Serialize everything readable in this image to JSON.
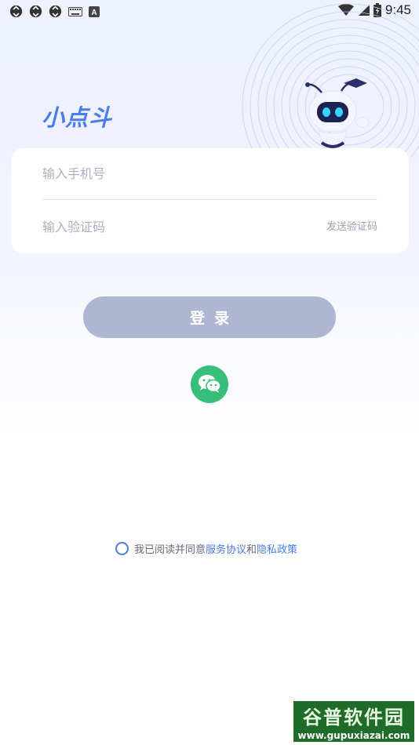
{
  "status_bar": {
    "time": "9:45",
    "left_icons": [
      "sync-icon",
      "sync-icon",
      "sync-icon",
      "keyboard-icon",
      "a-icon"
    ],
    "right_icons": [
      "wifi-icon",
      "signal-icon",
      "battery-icon"
    ]
  },
  "brand": {
    "name": "小点斗"
  },
  "form": {
    "phone_placeholder": "输入手机号",
    "code_placeholder": "输入验证码",
    "send_code_label": "发送验证码"
  },
  "login": {
    "label": "登录"
  },
  "wechat": {
    "icon": "wechat-icon",
    "color": "#37bf79"
  },
  "agreement": {
    "prefix": "我已阅读并同意",
    "service_link": "服务协议",
    "connector": "和",
    "privacy_link": "隐私政策"
  },
  "watermark": {
    "title": "谷普软件园",
    "url": "www.gupuxiazai.com"
  },
  "colors": {
    "accent": "#4a7df0",
    "button_disabled": "#afb6d1",
    "wechat": "#37bf79"
  }
}
